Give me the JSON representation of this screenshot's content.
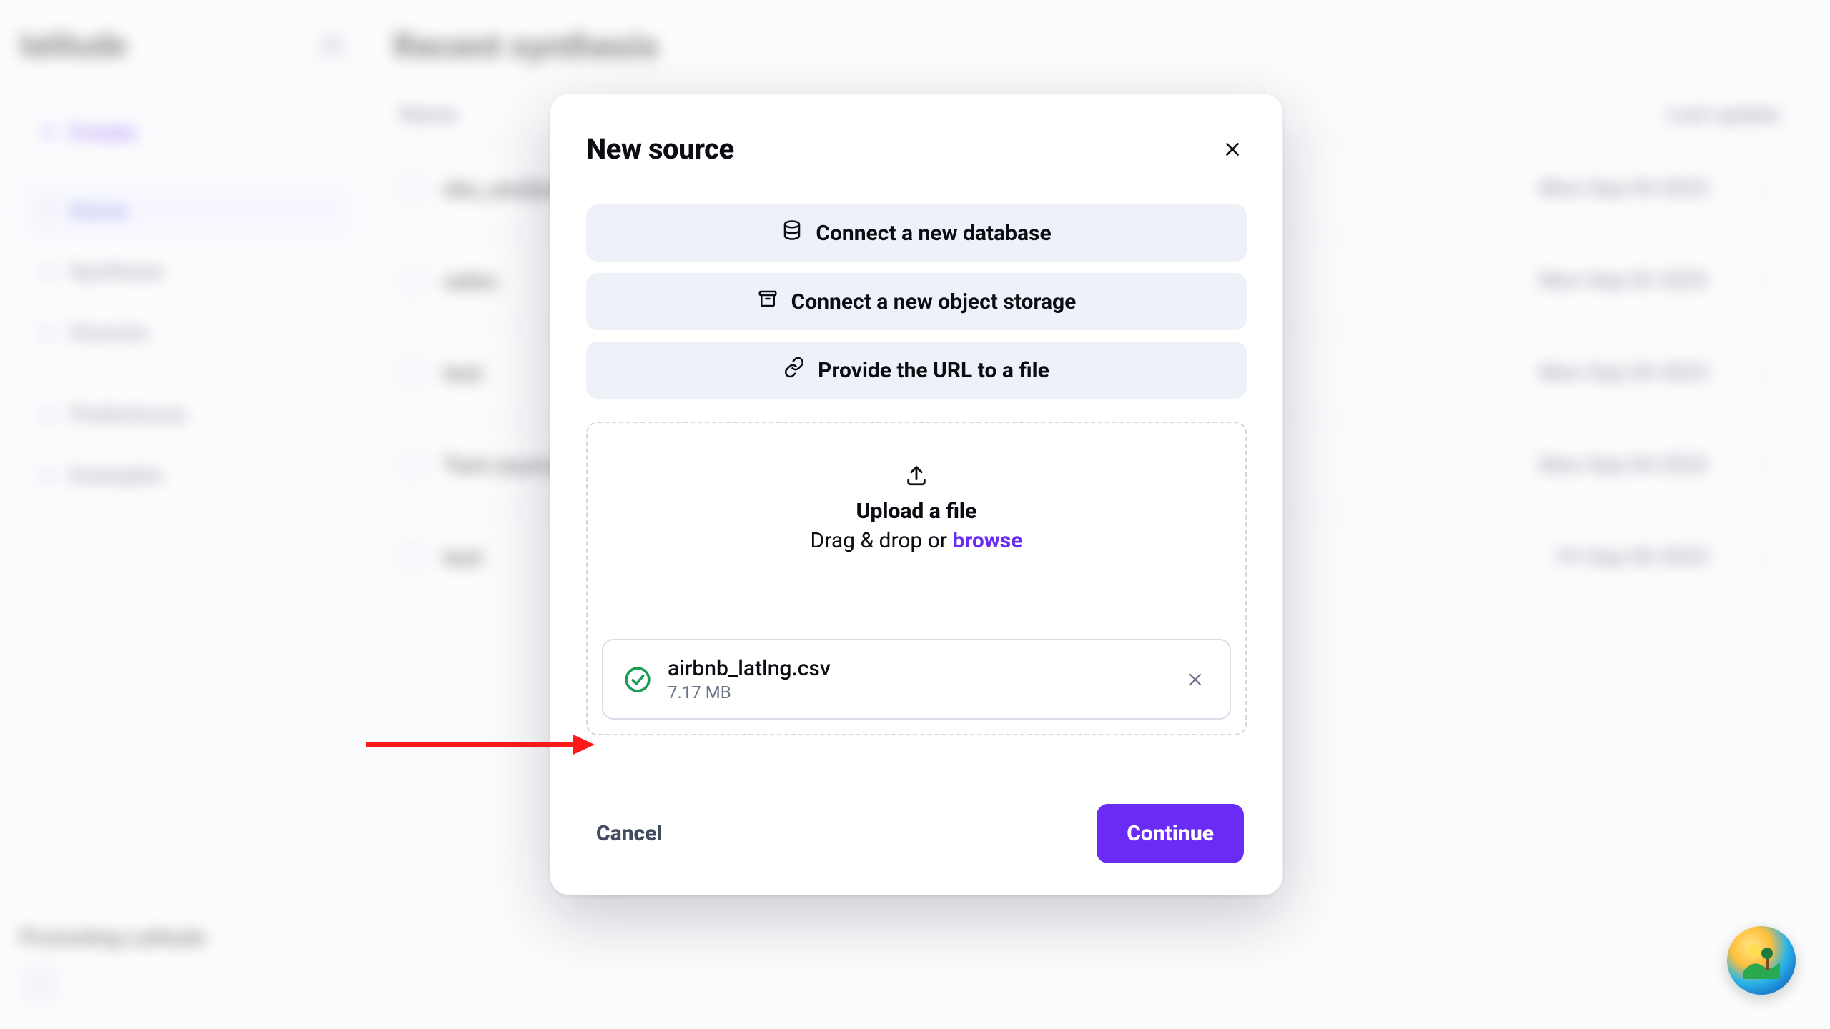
{
  "brand": "latitude",
  "create_label": "Create",
  "sidebar": {
    "items": [
      {
        "label": "Home"
      },
      {
        "label": "Synthesis"
      },
      {
        "label": "Sources"
      },
      {
        "label": "Preferences"
      },
      {
        "label": "Examples"
      }
    ]
  },
  "promo_title": "Promoting Latitude",
  "main": {
    "heading": "Recent synthesis",
    "col_name": "Name",
    "col_date": "Last update",
    "rows": [
      {
        "name": "sku_analysis",
        "date": "Mon Sep 04 2023"
      },
      {
        "name": "sales",
        "date": "Mon Sep 02 2023"
      },
      {
        "name": "test",
        "date": "Mon Sep 04 2023"
      },
      {
        "name": "Test source",
        "date": "Mon Sep 04 2023"
      },
      {
        "name": "test",
        "date": "Fri Sep 06 2023"
      }
    ]
  },
  "modal": {
    "title": "New source",
    "opt_db": "Connect a new database",
    "opt_storage": "Connect a new object storage",
    "opt_url": "Provide the URL to a file",
    "dz_title": "Upload a file",
    "dz_sub_prefix": "Drag & drop or ",
    "dz_browse": "browse",
    "file_name": "airbnb_latlng.csv",
    "file_size": "7.17 MB",
    "cancel": "Cancel",
    "continue": "Continue"
  }
}
